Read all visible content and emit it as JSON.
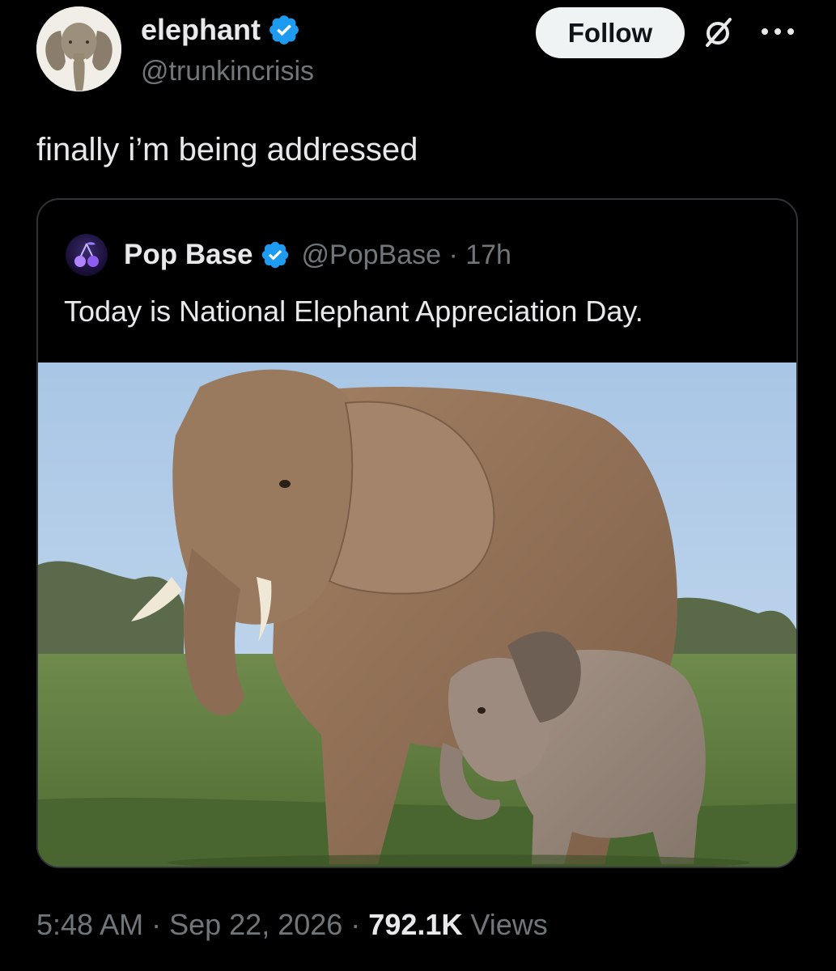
{
  "author": {
    "name": "elephant",
    "handle": "@trunkincrisis",
    "verified": true,
    "avatar": "elephant-head-avatar"
  },
  "actions": {
    "follow_label": "Follow",
    "grok_icon": "grok-slashed-circle-icon",
    "more_icon": "more-dots-icon"
  },
  "tweet": {
    "text": "finally i’m being addressed"
  },
  "quote": {
    "name": "Pop Base",
    "handle": "@PopBase",
    "separator": " · ",
    "time": "17h",
    "verified": true,
    "avatar": "cherries-logo-avatar",
    "text": "Today is National Elephant Appreciation Day.",
    "media": "photo-elephant-mother-and-calf"
  },
  "meta": {
    "time": "5:48 AM",
    "sep1": " · ",
    "date": "Sep 22, 2026",
    "sep2": " · ",
    "views_count": "792.1K",
    "views_label": " Views"
  },
  "colors": {
    "background": "#000000",
    "text_primary": "#e7e9ea",
    "text_secondary": "#71767b",
    "verified_blue": "#1d9bf0",
    "follow_bg": "#eff3f4",
    "border": "#2f3336"
  }
}
